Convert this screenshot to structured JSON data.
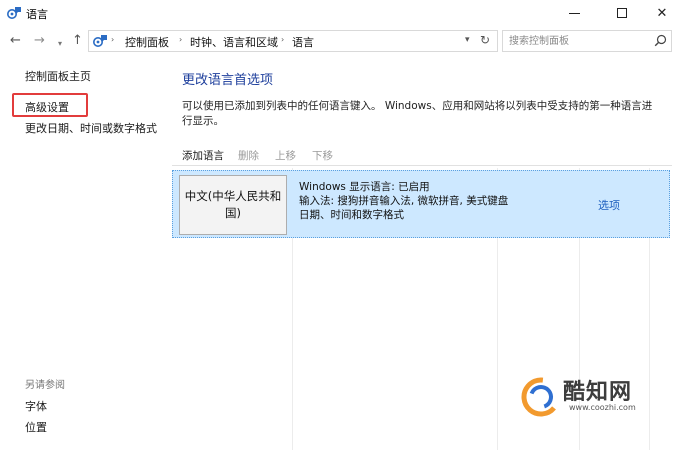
{
  "window": {
    "title": "语言",
    "icon": "language-gear-icon"
  },
  "nav": {
    "breadcrumbs": [
      "控制面板",
      "时钟、语言和区域",
      "语言"
    ],
    "search_placeholder": "搜索控制面板"
  },
  "left": {
    "home": "控制面板主页",
    "advanced": "高级设置",
    "date_format": "更改日期、时间或数字格式",
    "see_also": "另请参阅",
    "font": "字体",
    "location": "位置"
  },
  "main": {
    "title": "更改语言首选项",
    "description": "可以使用已添加到列表中的任何语言键入。 Windows、应用和网站将以列表中受支持的第一种语言进行显示。",
    "toolbar": {
      "add": "添加语言",
      "remove": "删除",
      "move_up": "上移",
      "move_down": "下移"
    },
    "languages": [
      {
        "name": "中文(中华人民共和国)",
        "display": "Windows 显示语言: 已启用",
        "input": "输入法: 搜狗拼音输入法, 微软拼音, 美式键盘",
        "format": "日期、时间和数字格式",
        "options": "选项"
      }
    ]
  },
  "watermark": {
    "name": "酷知网",
    "url": "www.coozhi.com"
  },
  "colors": {
    "link": "#1e3f9c",
    "selected_row": "#cde8ff",
    "highlight_box": "#e23c3c"
  }
}
